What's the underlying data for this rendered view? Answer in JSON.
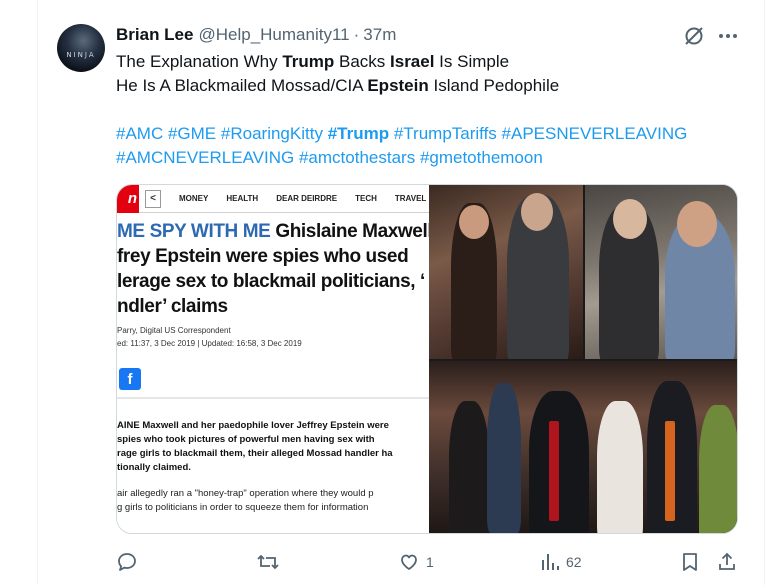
{
  "tweet": {
    "display_name": "Brian Lee",
    "handle": "@Help_Humanity11",
    "separator": "·",
    "time": "37m",
    "avatar_text": "NINJA",
    "text_lines": [
      [
        {
          "t": "The Explanation Why ",
          "s": "plain"
        },
        {
          "t": "Trump",
          "s": "bold"
        },
        {
          "t": " Backs ",
          "s": "plain"
        },
        {
          "t": "Israel",
          "s": "bold"
        },
        {
          "t": " Is Simple",
          "s": "plain"
        }
      ],
      [
        {
          "t": "He Is A Blackmailed Mossad/CIA ",
          "s": "plain"
        },
        {
          "t": "Epstein",
          "s": "bold"
        },
        {
          "t": " Island Pedophile",
          "s": "plain"
        }
      ],
      [],
      [
        {
          "t": "#AMC",
          "s": "tag"
        },
        {
          "t": " ",
          "s": "plain"
        },
        {
          "t": "#GME",
          "s": "tag"
        },
        {
          "t": " ",
          "s": "plain"
        },
        {
          "t": "#RoaringKitty",
          "s": "tag"
        },
        {
          "t": " ",
          "s": "plain"
        },
        {
          "t": "#Trump",
          "s": "tagbold"
        },
        {
          "t": " ",
          "s": "plain"
        },
        {
          "t": "#TrumpTariffs",
          "s": "tag"
        },
        {
          "t": " ",
          "s": "plain"
        },
        {
          "t": "#APESNEVERLEAVING",
          "s": "tag"
        }
      ],
      [
        {
          "t": "#AMCNEVERLEAVING",
          "s": "tag"
        },
        {
          "t": " ",
          "s": "plain"
        },
        {
          "t": "#amctothestars",
          "s": "tag"
        },
        {
          "t": " ",
          "s": "plain"
        },
        {
          "t": "#gmetothemoon",
          "s": "tag"
        }
      ]
    ]
  },
  "article": {
    "logo": "n",
    "back": "<",
    "nav": [
      "MONEY",
      "HEALTH",
      "DEAR DEIRDRE",
      "TECH",
      "TRAVEL"
    ],
    "headline_lines": [
      {
        "blue": "ME SPY WITH ME",
        "rest": " Ghislaine Maxwell a"
      },
      {
        "blue": "",
        "rest": "frey Epstein were spies who used"
      },
      {
        "blue": "",
        "rest": "lerage sex to blackmail politicians, ‘"
      },
      {
        "blue": "",
        "rest": "ndler’ claims"
      }
    ],
    "byline_1": "Parry, Digital US Correspondent",
    "byline_2": "ed: 11:37, 3 Dec 2019  |  Updated: 16:58, 3 Dec 2019",
    "fb_label": "f",
    "lead_lines": [
      "AINE Maxwell and her paedophile lover Jeffrey Epstein were",
      "spies who took pictures of powerful men having sex with",
      "rage girls to blackmail them, their alleged Mossad handler ha",
      "tionally claimed."
    ],
    "body_lines": [
      "air allegedly ran a \"honey-trap\" operation where they would p",
      "g girls to politicians in order to squeeze them for information"
    ]
  },
  "actions": {
    "reply_count": "",
    "retweet_count": "",
    "like_count": "1",
    "views_count": "62"
  },
  "colors": {
    "accent": "#1d9bf0",
    "secondary_text": "#536471",
    "headline_blue": "#2d6ab3",
    "sun_red": "#e3000f"
  }
}
